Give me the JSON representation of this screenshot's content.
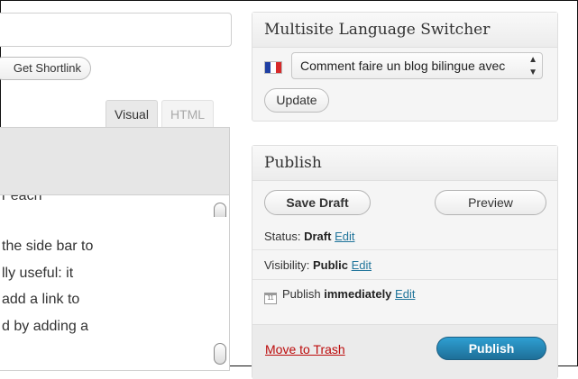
{
  "editor": {
    "shortlink_label": "Get Shortlink",
    "tabs": [
      {
        "label": "Visual",
        "active": true
      },
      {
        "label": "HTML",
        "active": false
      }
    ],
    "lines": [
      "r each",
      " the side bar to",
      "lly useful: it",
      " add a link to",
      "d by adding a"
    ]
  },
  "language_switcher": {
    "title": "Multisite Language Switcher",
    "flag": "french-flag",
    "selected_option": "Comment faire un blog bilingue avec",
    "update_label": "Update"
  },
  "publish": {
    "title": "Publish",
    "save_draft_label": "Save Draft",
    "preview_label": "Preview",
    "status_label": "Status:",
    "status_value": "Draft",
    "visibility_label": "Visibility:",
    "visibility_value": "Public",
    "schedule_label": "Publish",
    "schedule_value": "immediately",
    "edit_label": "Edit",
    "trash_label": "Move to Trash",
    "publish_label": "Publish"
  },
  "colors": {
    "link": "#21759b",
    "trash": "#bc0b0b",
    "publish_button": "#2e9fd2"
  }
}
